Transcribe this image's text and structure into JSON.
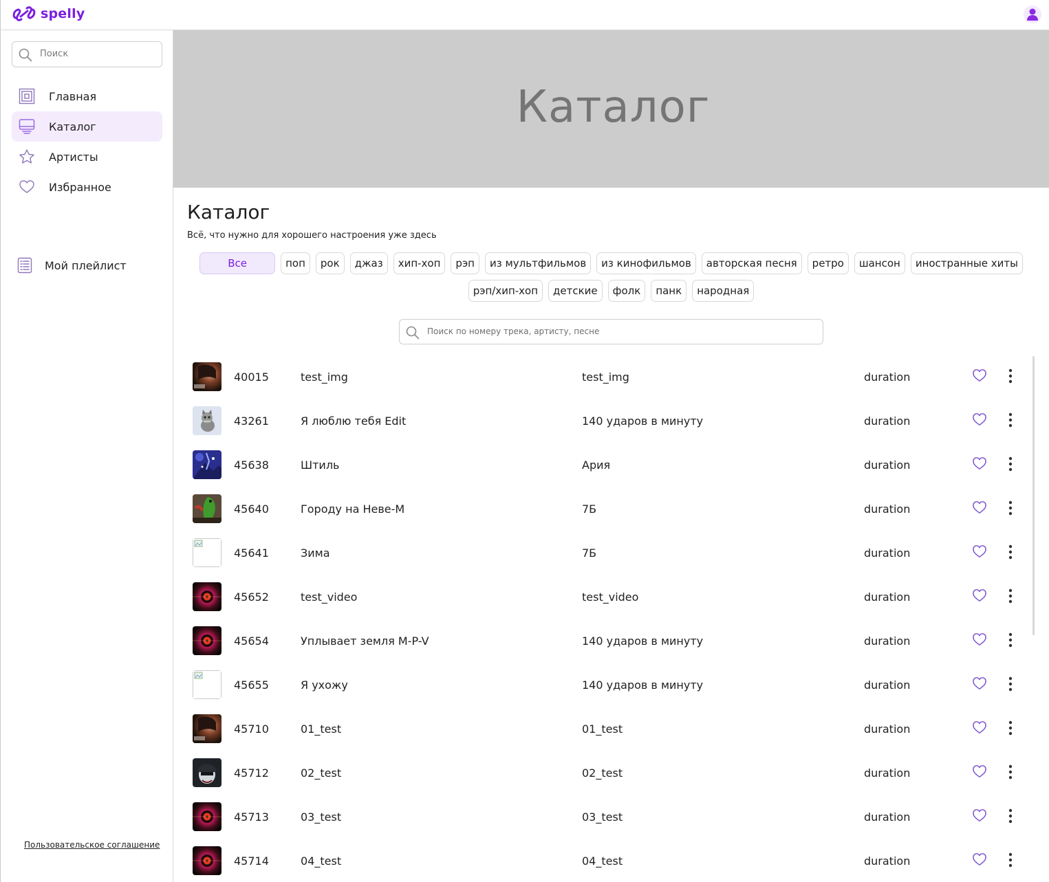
{
  "app": {
    "brand": "spelly",
    "brand_color": "#7b1fe0",
    "user_icon": "user-icon"
  },
  "sidebar": {
    "search_placeholder": "Поиск",
    "items": [
      {
        "label": "Главная",
        "icon": "home-icon",
        "active": false
      },
      {
        "label": "Каталог",
        "icon": "catalog-icon",
        "active": true
      },
      {
        "label": "Артисты",
        "icon": "star-icon",
        "active": false
      },
      {
        "label": "Избранное",
        "icon": "heart-icon",
        "active": false
      }
    ],
    "playlist_label": "Мой плейлист",
    "agreement_label": "Пользовательское соглашение"
  },
  "banner": {
    "text": "Каталог",
    "background": "#cccccc"
  },
  "page": {
    "title": "Каталог",
    "subtitle": "Всё, что нужно для хорошего настроения уже здесь",
    "genres_row1": [
      "Все",
      "поп",
      "рок",
      "джаз",
      "хип-хоп",
      "рэп",
      "из мультфильмов",
      "из кинофильмов",
      "авторская песня",
      "ретро",
      "шансон",
      "иностранные хиты"
    ],
    "genres_row2": [
      "рэп/хип-хоп",
      "детские",
      "фолк",
      "панк",
      "народная"
    ],
    "active_genre": "Все",
    "track_search_placeholder": "Поиск по номеру трека, артисту, песне"
  },
  "tracks": [
    {
      "num": "40015",
      "title": "test_img",
      "artist": "test_img",
      "duration": "duration",
      "cover": "portrait"
    },
    {
      "num": "43261",
      "title": "Я люблю тебя Edit",
      "artist": "140 ударов в минуту",
      "duration": "duration",
      "cover": "cat"
    },
    {
      "num": "45638",
      "title": "Штиль",
      "artist": "Ария",
      "duration": "duration",
      "cover": "blue"
    },
    {
      "num": "45640",
      "title": "Городу на Неве-М",
      "artist": "7Б",
      "duration": "duration",
      "cover": "parrot"
    },
    {
      "num": "45641",
      "title": "Зима",
      "artist": "7Б",
      "duration": "duration",
      "cover": "broken"
    },
    {
      "num": "45652",
      "title": "test_video",
      "artist": "test_video",
      "duration": "duration",
      "cover": "vinyl"
    },
    {
      "num": "45654",
      "title": "Уплывает земля M-P-V",
      "artist": "140 ударов в минуту",
      "duration": "duration",
      "cover": "vinyl"
    },
    {
      "num": "45655",
      "title": "Я ухожу",
      "artist": "140 ударов в минуту",
      "duration": "duration",
      "cover": "broken"
    },
    {
      "num": "45710",
      "title": "01_test",
      "artist": "01_test",
      "duration": "duration",
      "cover": "portrait"
    },
    {
      "num": "45712",
      "title": "02_test",
      "artist": "02_test",
      "duration": "duration",
      "cover": "dark"
    },
    {
      "num": "45713",
      "title": "03_test",
      "artist": "03_test",
      "duration": "duration",
      "cover": "vinyl"
    },
    {
      "num": "45714",
      "title": "04_test",
      "artist": "04_test",
      "duration": "duration",
      "cover": "vinyl"
    }
  ]
}
